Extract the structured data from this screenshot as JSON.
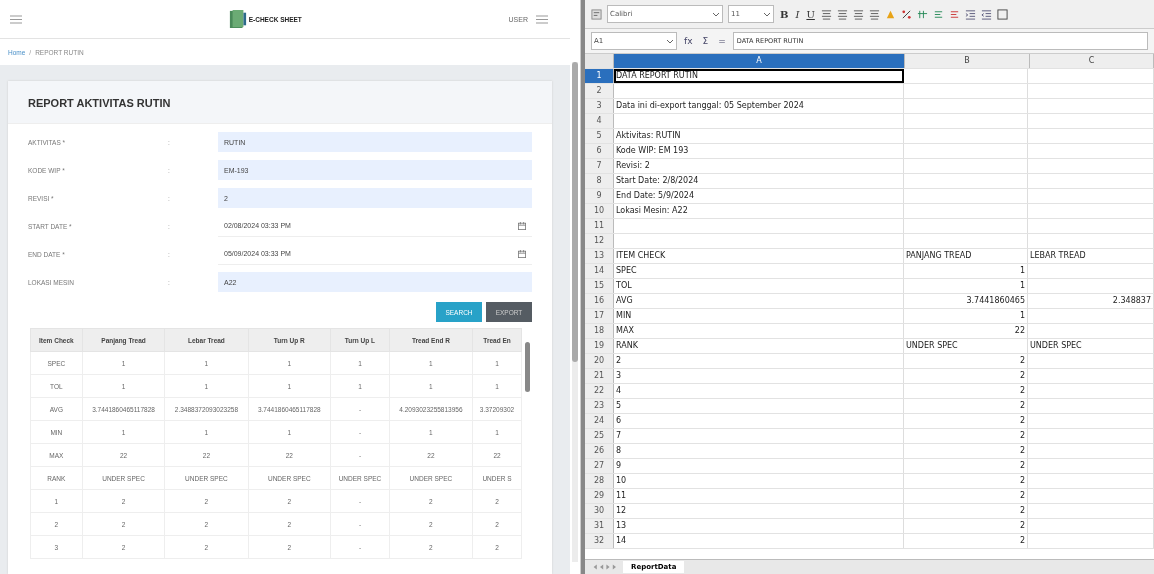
{
  "app": {
    "logo": "E-CHECK SHEET",
    "user": "USER",
    "breadcrumb_separator": "/",
    "breadcrumb": [
      {
        "label": "Home",
        "kind": "link"
      },
      {
        "label": "REPORT RUTIN",
        "kind": "current"
      }
    ],
    "card_title": "REPORT AKTIVITAS RUTIN",
    "form": [
      {
        "label": "AKTIVITAS *",
        "sep": ":",
        "value": "RUTIN",
        "kind": "text"
      },
      {
        "label": "KODE WIP *",
        "sep": ":",
        "value": "EM-193",
        "kind": "text"
      },
      {
        "label": "REVISI *",
        "sep": ":",
        "value": "2",
        "kind": "text"
      },
      {
        "label": "START DATE *",
        "sep": ":",
        "value": "02/08/2024 03:33 PM",
        "kind": "date"
      },
      {
        "label": "END DATE *",
        "sep": ":",
        "value": "05/09/2024 03:33 PM",
        "kind": "date"
      },
      {
        "label": "LOKASI MESIN",
        "sep": ":",
        "value": "A22",
        "kind": "text"
      }
    ],
    "buttons": [
      {
        "label": "SEARCH",
        "kind": "primary"
      },
      {
        "label": "EXPORT",
        "kind": "dark"
      }
    ],
    "table": {
      "columns": [
        "Item Check",
        "Panjang Tread",
        "Lebar Tread",
        "Turn Up R",
        "Turn Up L",
        "Tread End R",
        "Tread En"
      ],
      "rows": [
        [
          "SPEC",
          "1",
          "1",
          "1",
          "1",
          "1",
          "1"
        ],
        [
          "TOL",
          "1",
          "1",
          "1",
          "1",
          "1",
          "1"
        ],
        [
          "AVG",
          "3.7441860465117828",
          "2.3488372093023258",
          "3.7441860465117828",
          "-",
          "4.2093023255813956",
          "3.37209302"
        ],
        [
          "MIN",
          "1",
          "1",
          "1",
          "-",
          "1",
          "1"
        ],
        [
          "MAX",
          "22",
          "22",
          "22",
          "-",
          "22",
          "22"
        ],
        [
          "RANK",
          "UNDER SPEC",
          "UNDER SPEC",
          "UNDER SPEC",
          "UNDER SPEC",
          "UNDER SPEC",
          "UNDER S"
        ],
        [
          "1",
          "2",
          "2",
          "2",
          "-",
          "2",
          "2"
        ],
        [
          "2",
          "2",
          "2",
          "2",
          "-",
          "2",
          "2"
        ],
        [
          "3",
          "2",
          "2",
          "2",
          "-",
          "2",
          "2"
        ]
      ]
    }
  },
  "spreadsheet": {
    "font": "Calibri",
    "size": "11",
    "format_buttons": [
      "B",
      "I",
      "U"
    ],
    "name_box": "A1",
    "formula_symbols": [
      "fx",
      "Σ",
      "="
    ],
    "formula": "DATA REPORT RUTIN",
    "columns": [
      {
        "label": "A",
        "selected": true
      },
      {
        "label": "B",
        "selected": false
      },
      {
        "label": "C",
        "selected": false
      }
    ],
    "rows": [
      {
        "n": "1",
        "a": "DATA REPORT RUTIN",
        "kind": "text",
        "selected": true
      },
      {
        "n": "2",
        "kind": "text",
        "selected": false
      },
      {
        "n": "3",
        "a": "Data ini di-export tanggal: 05 September 2024",
        "kind": "text",
        "selected": false
      },
      {
        "n": "4",
        "kind": "text",
        "selected": false
      },
      {
        "n": "5",
        "a": "Aktivitas: RUTIN",
        "kind": "text",
        "selected": false
      },
      {
        "n": "6",
        "a": "Kode WIP: EM 193",
        "kind": "text",
        "selected": false
      },
      {
        "n": "7",
        "a": "Revisi: 2",
        "kind": "text",
        "selected": false
      },
      {
        "n": "8",
        "a": "Start Date: 2/8/2024",
        "kind": "text",
        "selected": false
      },
      {
        "n": "9",
        "a": "End Date: 5/9/2024",
        "kind": "text",
        "selected": false
      },
      {
        "n": "10",
        "a": "Lokasi Mesin: A22",
        "kind": "text",
        "selected": false
      },
      {
        "n": "11",
        "kind": "text",
        "selected": false
      },
      {
        "n": "12",
        "kind": "text",
        "selected": false
      },
      {
        "n": "13",
        "a": "ITEM CHECK",
        "b": "PANJANG TREAD",
        "c": "LEBAR TREAD",
        "kind": "text",
        "selected": false
      },
      {
        "n": "14",
        "a": "SPEC",
        "b": "1",
        "kind": "number",
        "selected": false
      },
      {
        "n": "15",
        "a": "TOL",
        "b": "1",
        "kind": "number",
        "selected": false
      },
      {
        "n": "16",
        "a": "AVG",
        "b": "3.7441860465",
        "c": "2.348837",
        "kind": "number",
        "selected": false
      },
      {
        "n": "17",
        "a": "MIN",
        "b": "1",
        "kind": "number",
        "selected": false
      },
      {
        "n": "18",
        "a": "MAX",
        "b": "22",
        "kind": "number",
        "selected": false
      },
      {
        "n": "19",
        "a": "RANK",
        "b": "UNDER SPEC",
        "c": "UNDER SPEC",
        "kind": "text",
        "selected": false
      },
      {
        "n": "20",
        "a": "2",
        "b": "2",
        "kind": "number",
        "selected": false
      },
      {
        "n": "21",
        "a": "3",
        "b": "2",
        "kind": "number",
        "selected": false
      },
      {
        "n": "22",
        "a": "4",
        "b": "2",
        "kind": "number",
        "selected": false
      },
      {
        "n": "23",
        "a": "5",
        "b": "2",
        "kind": "number",
        "selected": false
      },
      {
        "n": "24",
        "a": "6",
        "b": "2",
        "kind": "number",
        "selected": false
      },
      {
        "n": "25",
        "a": "7",
        "b": "2",
        "kind": "number",
        "selected": false
      },
      {
        "n": "26",
        "a": "8",
        "b": "2",
        "kind": "number",
        "selected": false
      },
      {
        "n": "27",
        "a": "9",
        "b": "2",
        "kind": "number",
        "selected": false
      },
      {
        "n": "28",
        "a": "10",
        "b": "2",
        "kind": "number",
        "selected": false
      },
      {
        "n": "29",
        "a": "11",
        "b": "2",
        "kind": "number",
        "selected": false
      },
      {
        "n": "30",
        "a": "12",
        "b": "2",
        "kind": "number",
        "selected": false
      },
      {
        "n": "31",
        "a": "13",
        "b": "2",
        "kind": "number",
        "selected": false
      },
      {
        "n": "32",
        "a": "14",
        "b": "2",
        "kind": "number",
        "selected": false
      }
    ],
    "sheets": [
      {
        "label": "ReportData",
        "selected": true
      }
    ]
  }
}
